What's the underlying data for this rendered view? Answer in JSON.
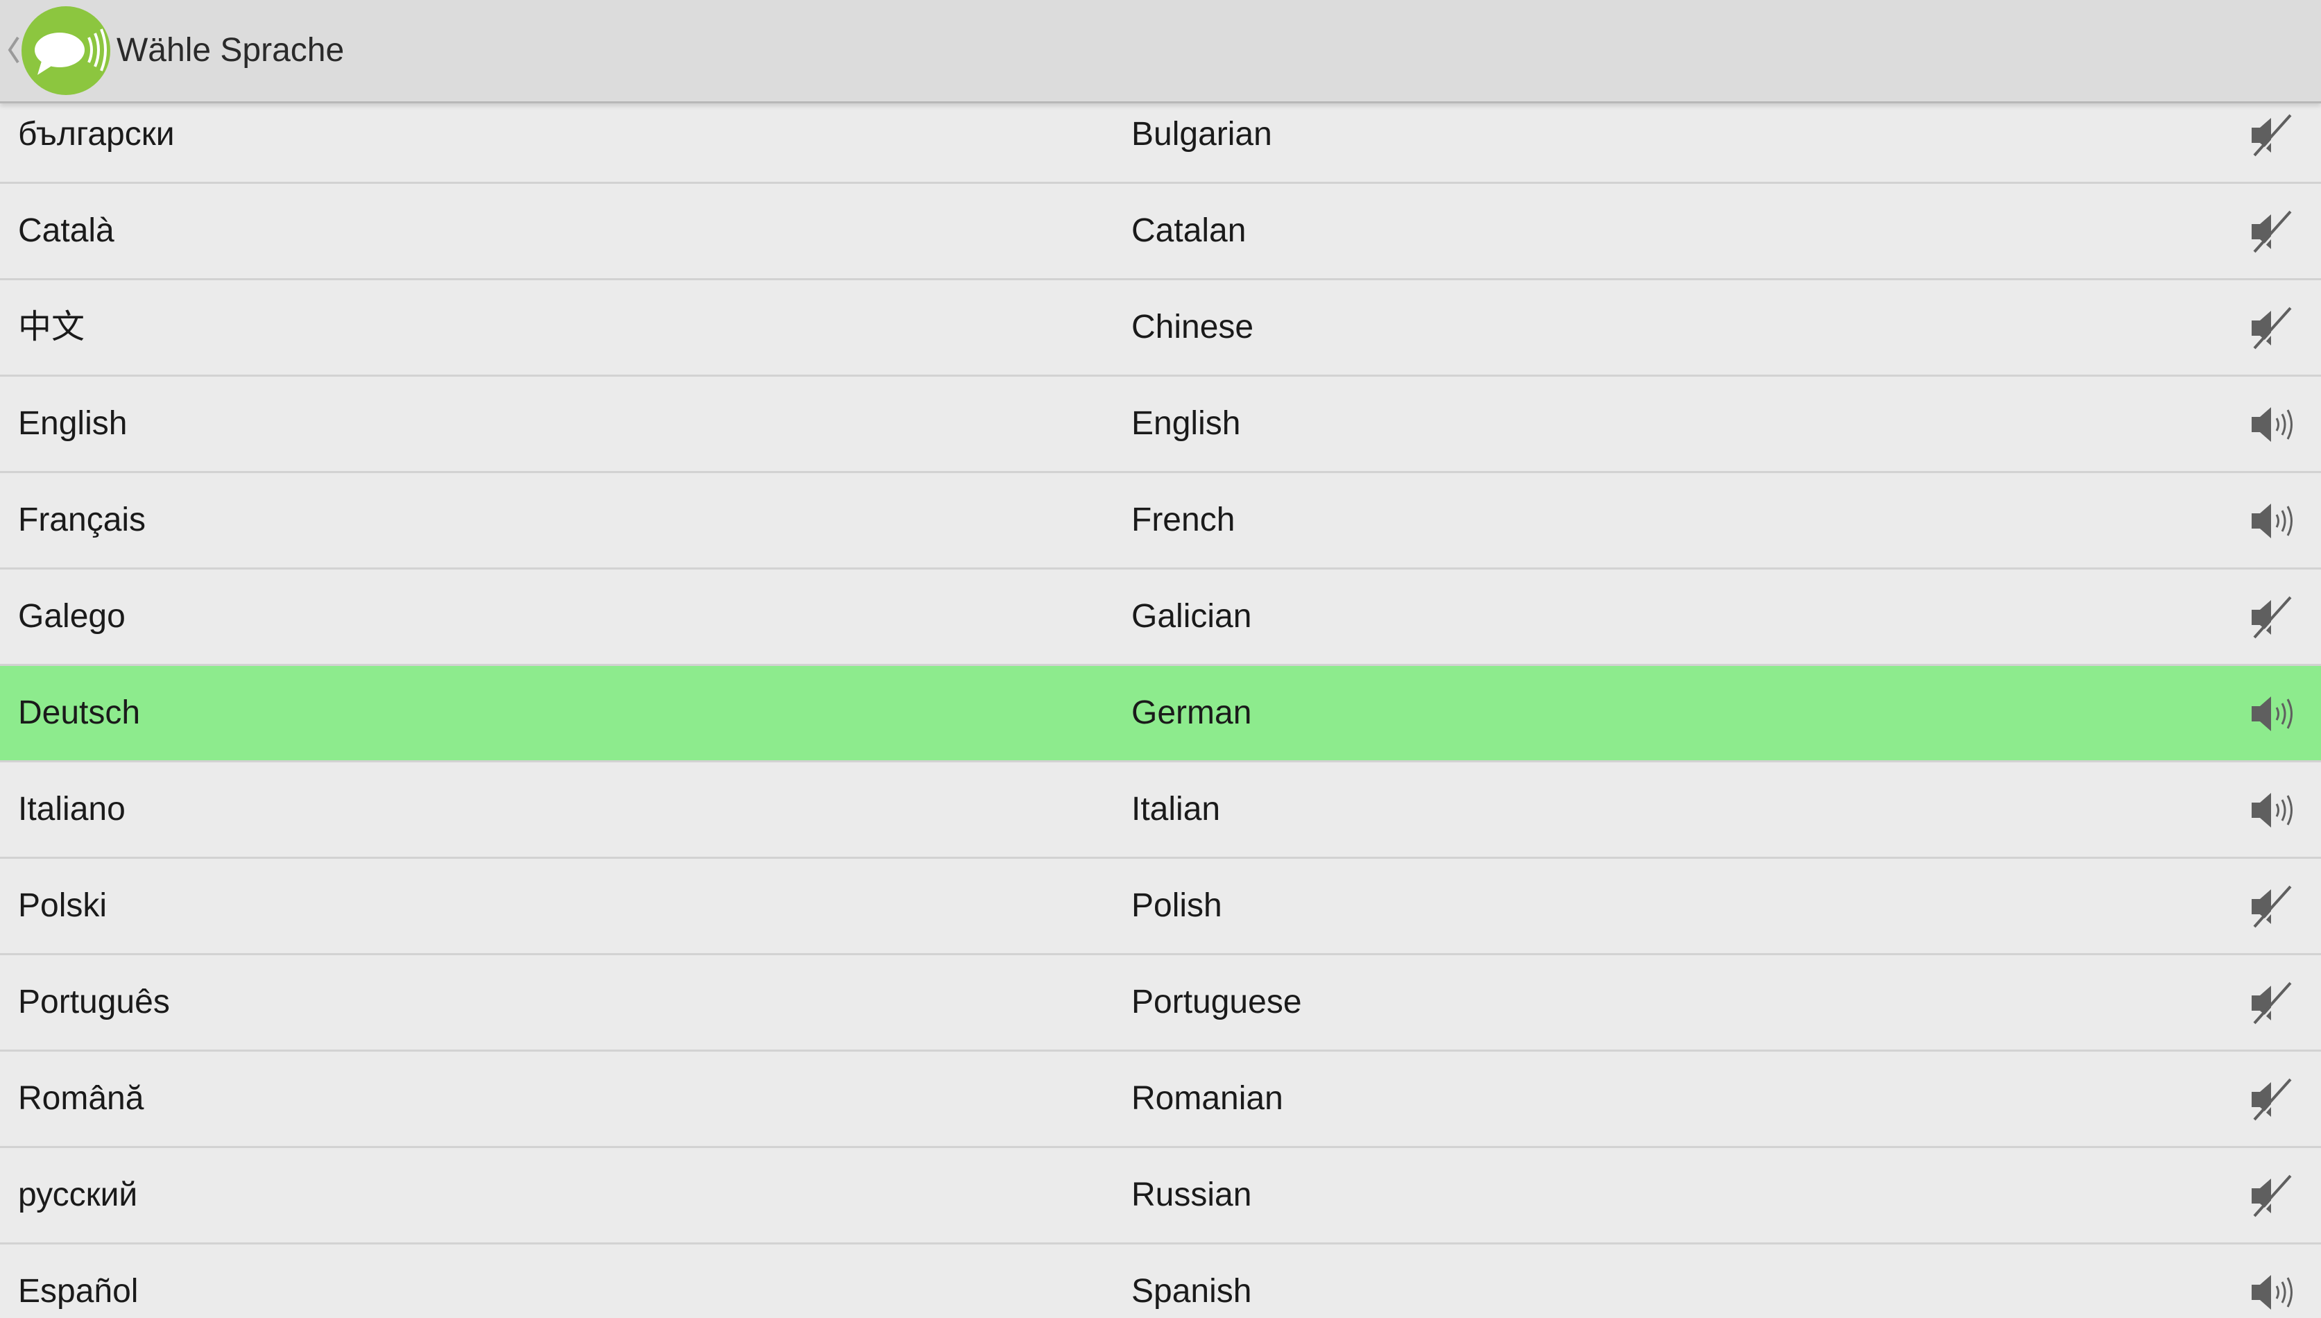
{
  "action_bar": {
    "title": "Wähle Sprache",
    "icons": {
      "up": "chevron-left-icon",
      "app": "speech-bubble-icon"
    },
    "app_icon_color": "#8cc63f"
  },
  "languages": [
    {
      "native": "български",
      "english": "Bulgarian",
      "voice": "muted",
      "selected": false
    },
    {
      "native": "Català",
      "english": "Catalan",
      "voice": "muted",
      "selected": false
    },
    {
      "native": "中文",
      "english": "Chinese",
      "voice": "muted",
      "selected": false
    },
    {
      "native": "English",
      "english": "English",
      "voice": "available",
      "selected": false
    },
    {
      "native": "Français",
      "english": "French",
      "voice": "available",
      "selected": false
    },
    {
      "native": "Galego",
      "english": "Galician",
      "voice": "muted",
      "selected": false
    },
    {
      "native": "Deutsch",
      "english": "German",
      "voice": "available",
      "selected": true
    },
    {
      "native": "Italiano",
      "english": "Italian",
      "voice": "available",
      "selected": false
    },
    {
      "native": "Polski",
      "english": "Polish",
      "voice": "muted",
      "selected": false
    },
    {
      "native": "Português",
      "english": "Portuguese",
      "voice": "muted",
      "selected": false
    },
    {
      "native": "Română",
      "english": "Romanian",
      "voice": "muted",
      "selected": false
    },
    {
      "native": "русский",
      "english": "Russian",
      "voice": "muted",
      "selected": false
    },
    {
      "native": "Español",
      "english": "Spanish",
      "voice": "available",
      "selected": false
    }
  ],
  "colors": {
    "selected_row": "#8deb8d",
    "row_background": "#ebebeb",
    "divider": "#d2d2d2",
    "icon_gray": "#5f5f5f"
  }
}
